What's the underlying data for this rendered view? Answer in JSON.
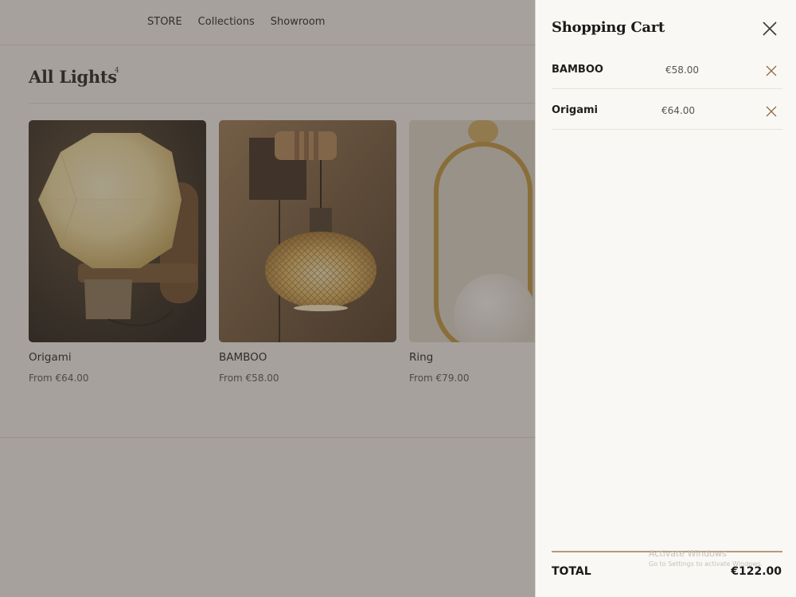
{
  "nav": {
    "items": [
      {
        "label": "STORE"
      },
      {
        "label": "Collections"
      },
      {
        "label": "Showroom"
      }
    ]
  },
  "collection": {
    "title": "All Lights",
    "count": "4"
  },
  "products": [
    {
      "name": "Origami",
      "price": "From €64.00",
      "image": "origami-wall-lamp"
    },
    {
      "name": "BAMBOO",
      "price": "From €58.00",
      "image": "bamboo-pendant-lamp"
    },
    {
      "name": "Ring",
      "price": "From €79.00",
      "image": "ring-wall-lamp"
    }
  ],
  "cart": {
    "title": "Shopping Cart",
    "items": [
      {
        "name": "BAMBOO",
        "price": "€58.00"
      },
      {
        "name": "Origami",
        "price": "€64.00"
      }
    ],
    "total_label": "TOTAL",
    "total_value": "€122.00"
  },
  "watermark": {
    "line1": "Activate Windows",
    "line2": "Go to Settings to activate Windows."
  },
  "colors": {
    "accent": "#b79878",
    "overlay": "#463e37",
    "drawer_bg": "#faf8f4"
  }
}
